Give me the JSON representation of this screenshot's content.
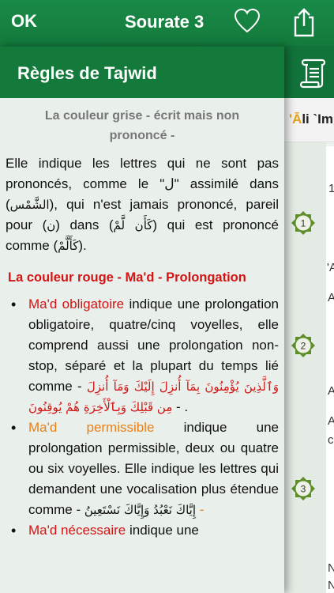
{
  "topbar": {
    "ok_label": "OK",
    "title": "Sourate 3",
    "heart_icon": "heart-outline-icon",
    "share_icon": "share-icon"
  },
  "underlying": {
    "title_highlight": "'Ā",
    "title_rest": "li `Im",
    "badges": [
      "1",
      "2",
      "3"
    ],
    "letters": [
      "1",
      "'A",
      "A",
      "A",
      "A",
      "c",
      "N",
      "N"
    ]
  },
  "panel": {
    "title": "Règles de Tajwid",
    "grey_title": "La couleur grise - écrit mais non prononcé -",
    "grey_para_1": "Elle indique les lettres qui ne sont pas prononcés, comme le \"ل\" assimilé dans (",
    "grey_para_ar1": "الشَّمْس",
    "grey_para_2": "), qui n'est jamais prononcé, pareil pour (",
    "grey_para_ar2": "ن",
    "grey_para_3": ") dans (",
    "grey_para_ar3": "كَأَن لَّمْ",
    "grey_para_4": ") qui est prononcé comme (",
    "grey_para_ar4": "كَأَلَّمْ",
    "grey_para_5": ").",
    "red_title": "La couleur rouge - Ma'd - Prolongation",
    "rules": [
      {
        "term": "Ma'd obligatoire",
        "text": " indique une prolongation obligatoire, quatre/cinq voyelles, elle comprend aussi une prolongation non-stop, séparé et la plupart du temps lié comme - ",
        "arabic": "وَٱلَّذِينَ يُؤْمِنُونَ بِمَآ أُنزِلَ إِلَيْكَ وَمَآ أُنزِلَ مِن قَبْلِكَ وَبِٱلْأَخِرَةِ هُمْ يُوقِنُونَ",
        "tail": " - ."
      },
      {
        "term": "Ma'd permissible",
        "text": " indique une prolongation permissible, deux ou quatre ou six voyelles. Elle indique les lettres qui demandent une vocalisation plus étendue comme - ",
        "arabic": "إِيَّاكَ نَعْبُدُ وَإِيَّاكَ نَسْتَعِينُ",
        "tail": " -"
      },
      {
        "term": "Ma'd nécessaire",
        "text": " indique une",
        "arabic": "",
        "tail": ""
      }
    ]
  },
  "colors": {
    "brand_green": "#137a3c",
    "grey_text": "#777777",
    "red": "#d21414",
    "orange": "#e8811a",
    "highlight_gold": "#e3a21a"
  }
}
